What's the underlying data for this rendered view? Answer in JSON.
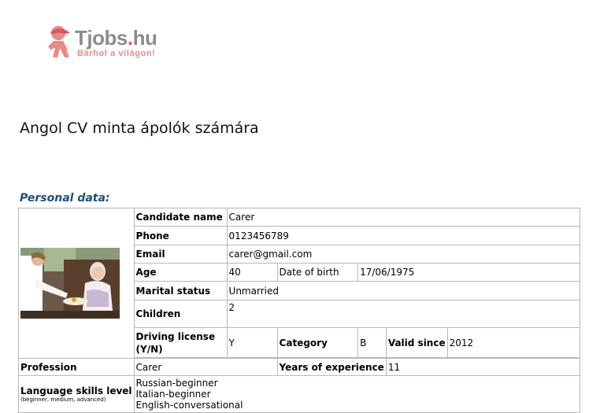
{
  "logo": {
    "brand_name": "Tjobs",
    "brand_dot": ".",
    "brand_tld": "hu",
    "tagline": "Bárhol a világon!",
    "accent": "#e05a5a"
  },
  "document": {
    "title": "Angol CV minta ápolók számára",
    "section_personal": "Personal data:",
    "section_color": "#1f4e79"
  },
  "personal": {
    "candidate_name_label": "Candidate name",
    "candidate_name": "Carer",
    "phone_label": "Phone",
    "phone": "0123456789",
    "email_label": "Email",
    "email": "carer@gmail.com",
    "age_label": "Age",
    "age": "40",
    "dob_label": "Date of birth",
    "dob": "17/06/1975",
    "marital_label": "Marital status",
    "marital": "Unmarried",
    "children_label": "Children",
    "children": "2",
    "driving_label": "Driving license (Y/N)",
    "driving": "Y",
    "category_label": "Category",
    "category": "B",
    "valid_since_label": "Valid since",
    "valid_since": "2012",
    "profession_label": "Profession",
    "profession": "Carer",
    "experience_label": "Years of experience",
    "experience": "11",
    "language_label": "Language skills level",
    "language_hint": "(beginner, medium, advanced)",
    "languages": [
      "Russian-beginner",
      "Italian-beginner",
      "English-conversational"
    ]
  }
}
